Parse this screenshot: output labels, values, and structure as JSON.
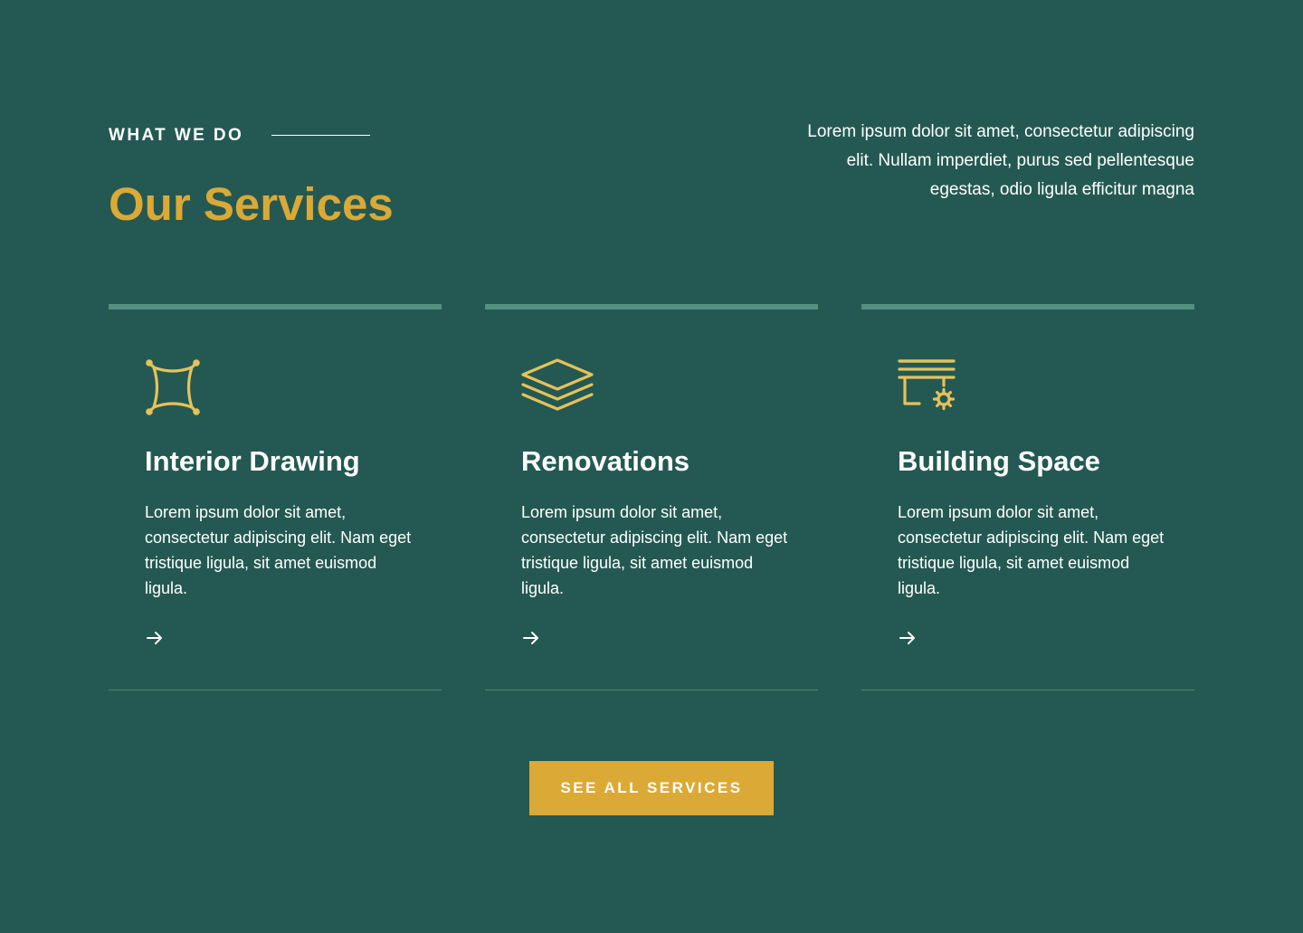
{
  "header": {
    "eyebrow": "WHAT WE DO",
    "title": "Our Services",
    "intro": "Lorem ipsum dolor sit amet, consectetur adipiscing elit. Nullam imperdiet, purus sed pellentesque egestas, odio ligula efficitur magna"
  },
  "services": [
    {
      "title": "Interior Drawing",
      "description": "Lorem ipsum dolor sit amet, consectetur adipiscing elit. Nam eget tristique ligula, sit amet euismod ligula.",
      "icon": "pillow-icon"
    },
    {
      "title": "Renovations",
      "description": "Lorem ipsum dolor sit amet, consectetur adipiscing elit. Nam eget tristique ligula, sit amet euismod ligula.",
      "icon": "layers-icon"
    },
    {
      "title": "Building Space",
      "description": "Lorem ipsum dolor sit amet, consectetur adipiscing elit. Nam eget tristique ligula, sit amet euismod ligula.",
      "icon": "blinds-gear-icon"
    }
  ],
  "cta": {
    "label": "SEE ALL SERVICES"
  },
  "colors": {
    "background": "#245953",
    "accent": "#dba936",
    "icon": "#e6c25a",
    "card_bar": "#55907f",
    "text": "#ffffff"
  }
}
